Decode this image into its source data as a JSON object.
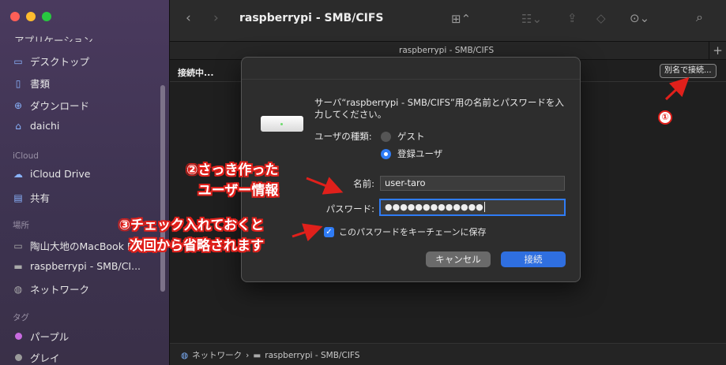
{
  "sidebar": {
    "cut_item": "アプリケーション",
    "favorites": [
      {
        "label": "デスクトップ",
        "icon": "desktop-icon"
      },
      {
        "label": "書類",
        "icon": "document-icon"
      },
      {
        "label": "ダウンロード",
        "icon": "download-icon"
      },
      {
        "label": "daichi",
        "icon": "home-icon"
      }
    ],
    "icloud_header": "iCloud",
    "icloud": [
      {
        "label": "iCloud Drive",
        "icon": "cloud-icon"
      },
      {
        "label": "共有",
        "icon": "shared-folder-icon"
      }
    ],
    "locations_header": "場所",
    "locations": [
      {
        "label": "陶山大地のMacBook P",
        "icon": "laptop-icon"
      },
      {
        "label": "raspberrypi - SMB/CI...",
        "icon": "server-icon"
      },
      {
        "label": "ネットワーク",
        "icon": "network-icon"
      }
    ],
    "tags_header": "タグ",
    "tags": [
      {
        "label": "パープル",
        "color": "#c86be0"
      },
      {
        "label": "グレイ",
        "color": "#9a9a9a"
      }
    ]
  },
  "toolbar": {
    "title": "raspberrypi - SMB/CIFS"
  },
  "tab": {
    "title": "raspberrypi - SMB/CIFS",
    "plus": "+"
  },
  "connect_bar": {
    "status": "接続中...",
    "alias_button": "別名で接続..."
  },
  "dialog": {
    "message": "サーバ“raspberrypi - SMB/CIFS”用の名前とパスワードを入力してください。",
    "user_type_label": "ユーザの種類:",
    "guest_label": "ゲスト",
    "registered_label": "登録ユーザ",
    "name_label": "名前:",
    "name_value": "user-taro",
    "password_label": "パスワード:",
    "password_value": "●●●●●●●●●●●●●",
    "keychain_label": "このパスワードをキーチェーンに保存",
    "cancel_button": "キャンセル",
    "connect_button": "接続"
  },
  "pathbar": {
    "items": [
      "ネットワーク",
      "raspberrypi - SMB/CIFS"
    ],
    "separator": "›"
  },
  "annotations": {
    "one": "①",
    "two_line1": "②さっき作った",
    "two_line2": "ユーザー情報",
    "three_line1": "③チェック入れておくと",
    "three_line2": "次回から省略されます"
  },
  "colors": {
    "accent": "#2f7cf6",
    "annotation_red": "#e0201b",
    "sidebar_bg": "#4a3a5e"
  }
}
